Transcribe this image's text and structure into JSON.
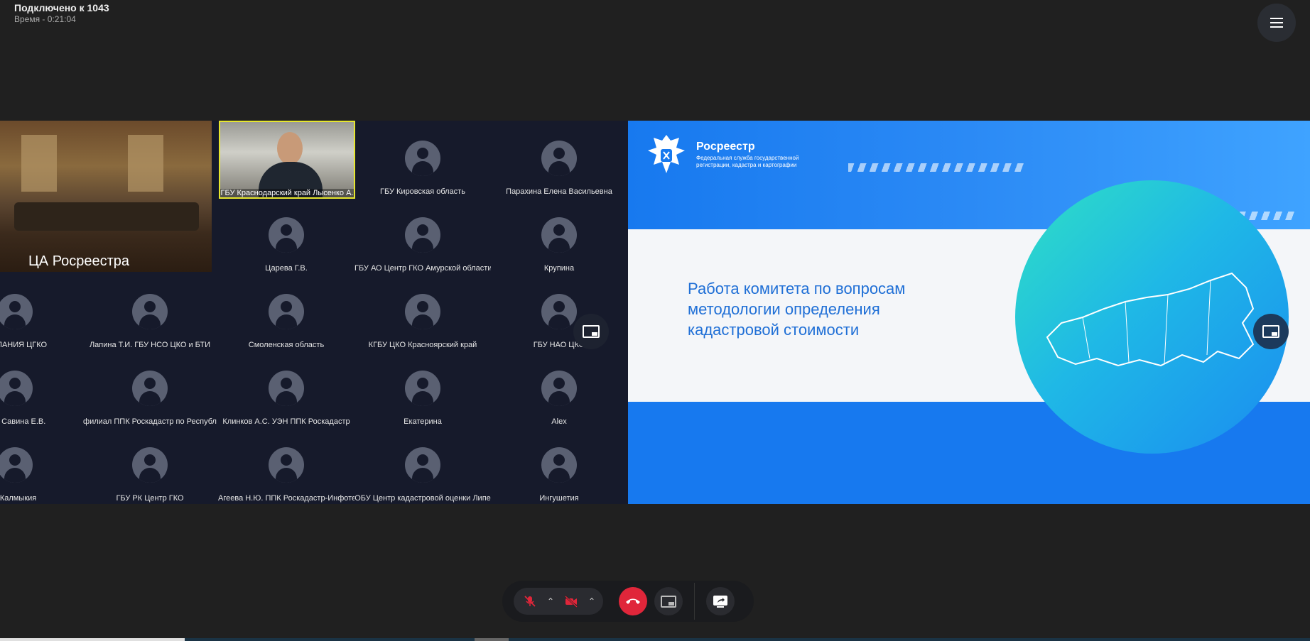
{
  "status": {
    "connected": "Подключено к 1043",
    "time": "Время - 0:21:04"
  },
  "gallery": {
    "room_label": "ЦА Росреестра",
    "speaker_name": "ГБУ Краснодарский край Лысенко А.",
    "participants": [
      "ГБУ Кировская область",
      "Парахина Елена Васильевна",
      "Царева Г.В.",
      "ГБУ АО Центр ГКО Амурской области",
      "Крупина",
      "О-АЛАНИЯ ЦГКО",
      "Лапина Т.И.  ГБУ НСО ЦКО и БТИ",
      "Смоленская область",
      "КГБУ ЦКО Красноярский край",
      "ГБУ НАО ЦКО",
      "БТИ Савина Е.В.",
      "филиал ППК Роскадастр по Республ",
      "Клинков А.С. УЭН ППК Роскадастр",
      "Екатерина",
      "Alex",
      "п Калмыкия",
      "ГБУ РК Центр ГКО",
      "Агеева Н.Ю. ППК Роскадастр-Инфоте",
      "ОБУ Центр кадастровой оценки Липе",
      "Ингушетия"
    ]
  },
  "slide": {
    "brand": "Росреестр",
    "brand_sub": "Федеральная служба государственной регистрации, кадастра и картографии",
    "title": "Работа комитета по вопросам методологии определения кадастровой стоимости"
  },
  "icons": {
    "menu": "hamburger-icon",
    "pip": "picture-in-picture-icon",
    "mic": "mic-off-icon",
    "camera": "camera-off-icon",
    "hangup": "phone-hangup-icon",
    "share": "screen-share-icon"
  },
  "colors": {
    "background": "#202020",
    "gallery_bg": "#161a2b",
    "speaker_border": "#e6e62e",
    "hangup": "#e0263a",
    "mic_off": "#e0263a",
    "slide_blue": "#1779ef"
  }
}
